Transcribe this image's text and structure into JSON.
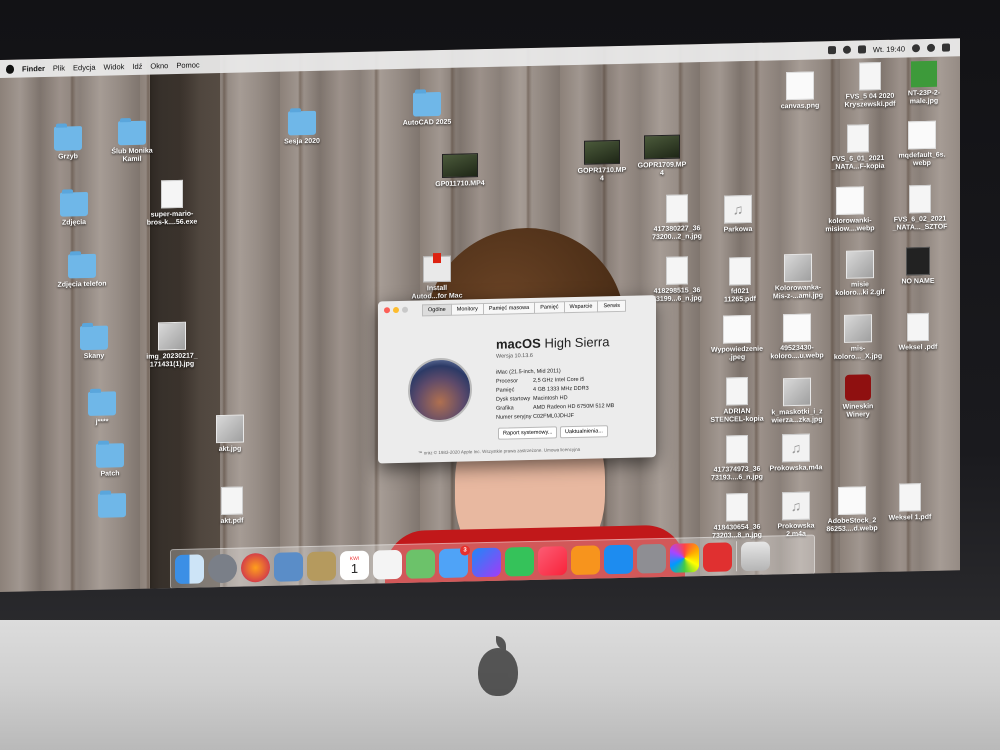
{
  "menubar": {
    "items": [
      "Finder",
      "Plik",
      "Edycja",
      "Widok",
      "Idź",
      "Okno",
      "Pomoc"
    ],
    "clock": "Wt. 19:40"
  },
  "desktop_icons": [
    {
      "label": "Grzyb",
      "kind": "folder"
    },
    {
      "label": "Ślub Monika\nKamil",
      "kind": "folder"
    },
    {
      "label": "Sesja 2020",
      "kind": "folder"
    },
    {
      "label": "AutoCAD 2025",
      "kind": "folder"
    },
    {
      "label": "super-mario-\nbros-k....56.exe",
      "kind": "doc"
    },
    {
      "label": "Zdjęcia",
      "kind": "folder"
    },
    {
      "label": "GP011710.MP4",
      "kind": "video"
    },
    {
      "label": "GOPR1710.MP\n4",
      "kind": "video"
    },
    {
      "label": "GOPR1709.MP\n4",
      "kind": "video"
    },
    {
      "label": "Zdjęcia telefon",
      "kind": "folder"
    },
    {
      "label": "Install\nAutod...for Mac",
      "kind": "pkg"
    },
    {
      "label": "Skany",
      "kind": "folder"
    },
    {
      "label": "img_20230217_\n171431(1).jpg",
      "kind": "img"
    },
    {
      "label": "j****",
      "kind": "folder"
    },
    {
      "label": "akt.jpg",
      "kind": "img"
    },
    {
      "label": "Patch",
      "kind": "folder"
    },
    {
      "label": "akt.pdf",
      "kind": "doc"
    },
    {
      "label": "",
      "kind": "folder"
    },
    {
      "label": "canvas.png",
      "kind": "outline"
    },
    {
      "label": "FVS_5 04 2020\nKryszewski.pdf",
      "kind": "doc"
    },
    {
      "label": "NT-23P-2-\nmale.jpg",
      "kind": "green"
    },
    {
      "label": "FVS_6_01_2021\n_NATA...F-kopia",
      "kind": "doc"
    },
    {
      "label": "mqdefault_6s.\nwebp",
      "kind": "outline"
    },
    {
      "label": "417380227_36\n73200...2_n.jpg",
      "kind": "doc"
    },
    {
      "label": "Parkowa",
      "kind": "music"
    },
    {
      "label": "kolorowanki-\nmisiow....webp",
      "kind": "outline"
    },
    {
      "label": "FVS_6_02_2021\n_NATA..._SZTOF",
      "kind": "doc"
    },
    {
      "label": "418298515_36\n73199...6_n.jpg",
      "kind": "doc"
    },
    {
      "label": "fd021\n11265.pdf",
      "kind": "doc"
    },
    {
      "label": "Kolorowanka-\nMis-z-...ami.jpg",
      "kind": "img"
    },
    {
      "label": "misie\nkoloro...ki 2.gif",
      "kind": "img"
    },
    {
      "label": "NO NAME",
      "kind": "dark"
    },
    {
      "label": "Wypowiedzenie\n.jpeg",
      "kind": "outline"
    },
    {
      "label": "49523430-\nkoloro....u.webp",
      "kind": "outline"
    },
    {
      "label": "mis-\nkoloro..._X.jpg",
      "kind": "img"
    },
    {
      "label": "Weksel .pdf",
      "kind": "doc"
    },
    {
      "label": "ADRIAN\nSTENCEL-kopia",
      "kind": "doc"
    },
    {
      "label": "k_maskotki_i_z\nwierza...zka.jpg",
      "kind": "img"
    },
    {
      "label": "Wineskin\nWinery",
      "kind": "wine"
    },
    {
      "label": "417374973_36\n73193....6_n.jpg",
      "kind": "doc"
    },
    {
      "label": "Prokowska.m4a",
      "kind": "music"
    },
    {
      "label": "418430654_36\n73203...8_n.jpg",
      "kind": "doc"
    },
    {
      "label": "Prokowska\n2.m4a",
      "kind": "music"
    },
    {
      "label": "AdobeStock_2\n86253....d.webp",
      "kind": "outline"
    },
    {
      "label": "Weksel 1.pdf",
      "kind": "doc"
    }
  ],
  "about_window": {
    "tabs": [
      "Ogólne",
      "Monitory",
      "Pamięć masowa",
      "Pamięć",
      "Wsparcie",
      "Serwis"
    ],
    "os_name": "macOS",
    "os_version_name": "High Sierra",
    "version": "Wersja 10.13.6",
    "specs": [
      {
        "key": "iMac (21.5-inch, Mid 2011)",
        "value": ""
      },
      {
        "key": "Procesor",
        "value": "2,5 GHz Intel Core i5"
      },
      {
        "key": "Pamięć",
        "value": "4 GB 1333 MHz DDR3"
      },
      {
        "key": "Dysk startowy",
        "value": "Macintosh HD"
      },
      {
        "key": "Grafika",
        "value": "AMD Radeon HD 6750M 512 MB"
      },
      {
        "key": "Numer seryjny",
        "value": "C02FML0JDHJF"
      }
    ],
    "button_report": "Raport systemowy...",
    "button_update": "Uaktualnienia...",
    "footer": "™ oraz © 1983-2020 Apple Inc. Wszystkie prawa zastrzeżone. Umowa licencyjna"
  },
  "dock": {
    "messages_badge": "3",
    "calendar_month": "KWI",
    "calendar_day": "1"
  },
  "colors": {
    "folder": "#6fb7e8",
    "shirt": "#c1181a",
    "badge": "#e8312d"
  }
}
